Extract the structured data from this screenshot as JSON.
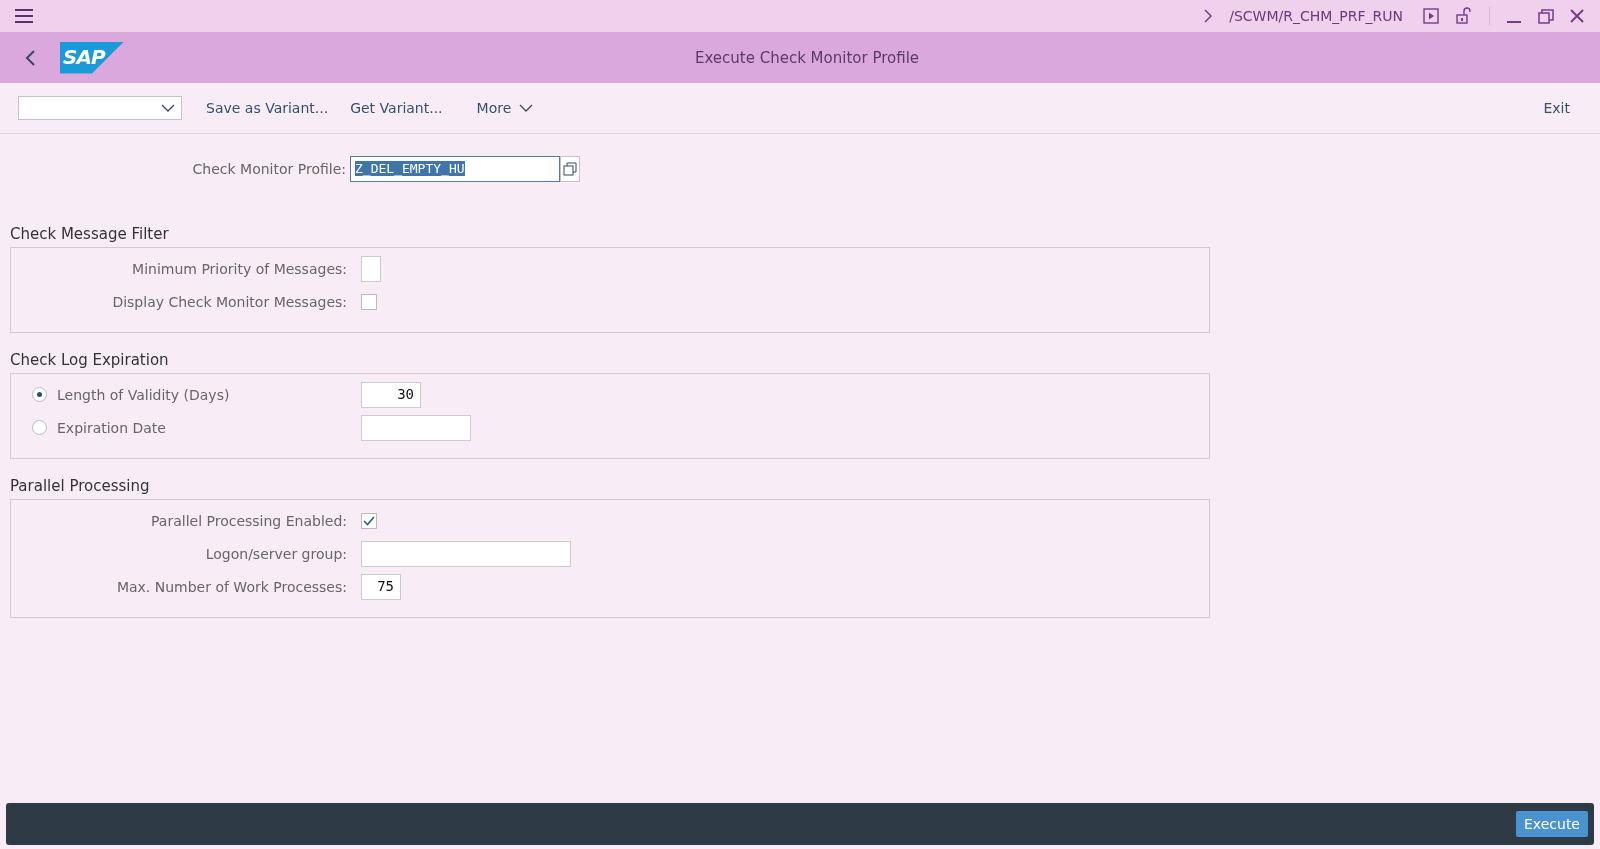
{
  "shell": {
    "transaction": "/SCWM/R_CHM_PRF_RUN"
  },
  "header": {
    "logo": "SAP",
    "title": "Execute Check Monitor Profile"
  },
  "toolbar": {
    "actions": [
      "Save as Variant...",
      "Get Variant..."
    ],
    "more": "More",
    "exit": "Exit"
  },
  "profile": {
    "label": "Check Monitor Profile:",
    "value": "Z_DEL_EMPTY_HU",
    "text_selected": true
  },
  "sections": [
    {
      "title": "Check Message Filter",
      "rows": [
        {
          "kind": "field",
          "label": "Minimum Priority of Messages:",
          "value": ""
        },
        {
          "kind": "checkbox",
          "label": "Display Check Monitor Messages:",
          "checked": false
        }
      ]
    },
    {
      "title": "Check Log Expiration",
      "rows": [
        {
          "kind": "radio",
          "label": "Length of Validity (Days)",
          "selected": true,
          "value": "30"
        },
        {
          "kind": "radio",
          "label": "Expiration Date",
          "selected": false,
          "value": ""
        }
      ]
    },
    {
      "title": "Parallel Processing",
      "rows": [
        {
          "kind": "checkbox",
          "label": "Parallel Processing Enabled:",
          "checked": true
        },
        {
          "kind": "field",
          "label": "Logon/server group:",
          "value": ""
        },
        {
          "kind": "field",
          "label": "Max. Number of Work Processes:",
          "value": "75"
        }
      ]
    }
  ],
  "footer": {
    "button": "Execute"
  }
}
